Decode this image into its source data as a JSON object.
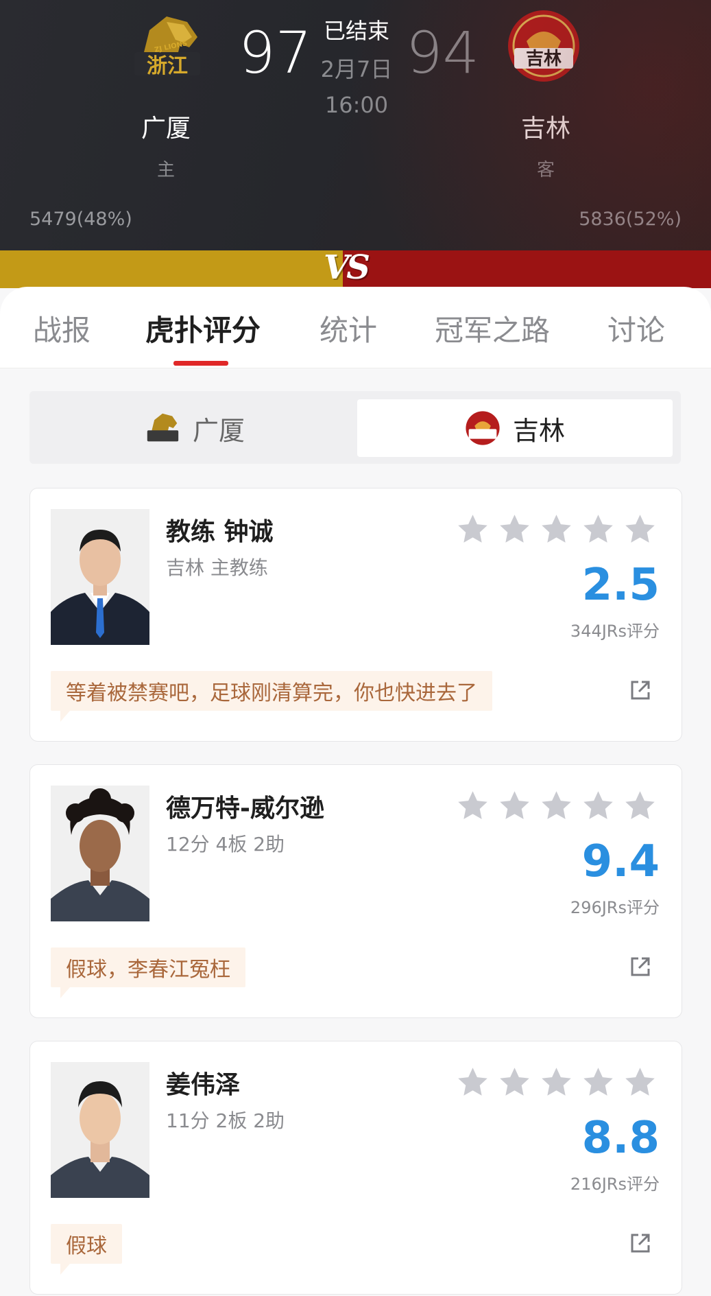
{
  "match": {
    "status": "已结束",
    "date": "2月7日",
    "time": "16:00",
    "home": {
      "name": "广厦",
      "role": "主",
      "score": "97",
      "votes": "5479(48%)",
      "logo_text": "浙江",
      "logo_sub": "ZJ LIONS"
    },
    "away": {
      "name": "吉林",
      "role": "客",
      "score": "94",
      "votes": "5836(52%)",
      "logo_text": "吉林"
    },
    "vs_label": "VS"
  },
  "tabs": [
    "战报",
    "虎扑评分",
    "统计",
    "冠军之路",
    "讨论"
  ],
  "active_tab": "虎扑评分",
  "team_switch": {
    "left": "广厦",
    "right": "吉林",
    "selected": "吉林"
  },
  "colors": {
    "accent": "#e02828",
    "rating": "#2a8fe0",
    "home_bar": "#c39a17",
    "away_bar": "#9b1313",
    "comment_text": "#a9673b"
  },
  "cards": [
    {
      "name": "教练 钟诚",
      "sub": "吉林 主教练",
      "rating": "2.5",
      "count": "344JRs评分",
      "comment": "等着被禁赛吧，足球刚清算完，你也快进去了",
      "stars_filled": 0
    },
    {
      "name": "德万特-威尔逊",
      "sub": "12分 4板 2助",
      "rating": "9.4",
      "count": "296JRs评分",
      "comment": "假球，李春江冤枉",
      "stars_filled": 0
    },
    {
      "name": "姜伟泽",
      "sub": "11分 2板 2助",
      "rating": "8.8",
      "count": "216JRs评分",
      "comment": "假球",
      "stars_filled": 0
    }
  ]
}
